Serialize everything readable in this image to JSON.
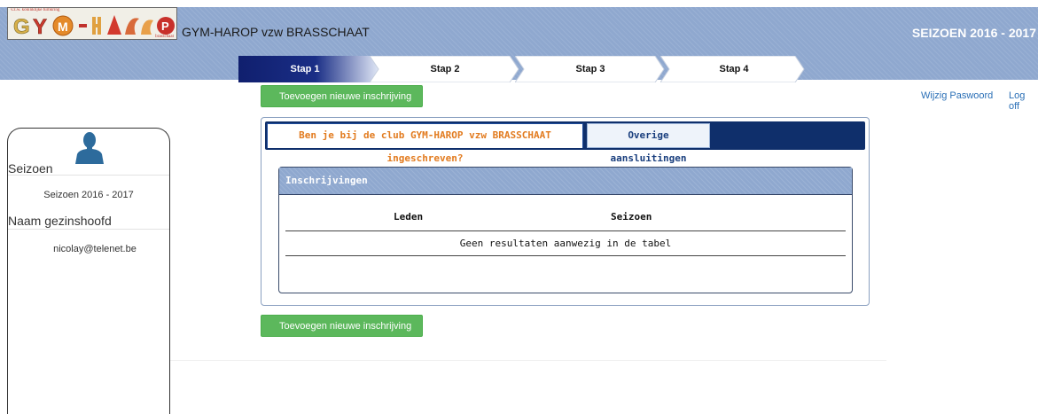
{
  "header": {
    "logo_text_top": "v.z.w. koninklijke turnkring",
    "logo_text_bottom": "brasschaat",
    "logo_letters": [
      "G",
      "Y",
      "M",
      "-",
      "H",
      "A",
      "R",
      "O",
      "P"
    ],
    "club_title": "GYM-HAROP vzw BRASSCHAAT",
    "season_title": "SEIZOEN 2016 - 2017"
  },
  "steps": [
    {
      "label": "Stap 1",
      "active": true
    },
    {
      "label": "Stap 2",
      "active": false
    },
    {
      "label": "Stap 3",
      "active": false
    },
    {
      "label": "Stap 4",
      "active": false
    }
  ],
  "top_links": {
    "change_password": "Wijzig Paswoord",
    "logoff": "Log off"
  },
  "buttons": {
    "add_top": "Toevoegen nieuwe inschrijving",
    "add_bottom": "Toevoegen nieuwe inschrijving"
  },
  "sidebar": {
    "icon": "user-icon",
    "season_heading": "Seizoen",
    "season_value": "Seizoen 2016 - 2017",
    "head_heading": "Naam gezinshoofd",
    "head_value": "nicolay@telenet.be"
  },
  "tabs": {
    "tab1": "Ben je bij de club GYM-HAROP vzw BRASSCHAAT ingeschreven?",
    "tab2": "Overige aansluitingen"
  },
  "table": {
    "title": "Inschrijvingen",
    "columns": [
      "Leden",
      "Seizoen"
    ],
    "empty_message": "Geen resultaten aanwezig in de tabel"
  },
  "colors": {
    "header_bg": "#8fa8cf",
    "tabbar_bg": "#0f2f6b",
    "active_step": "#13277a",
    "button_green": "#5cb85c",
    "tab_active_text": "#e27b1f",
    "link": "#2a6fb6"
  }
}
